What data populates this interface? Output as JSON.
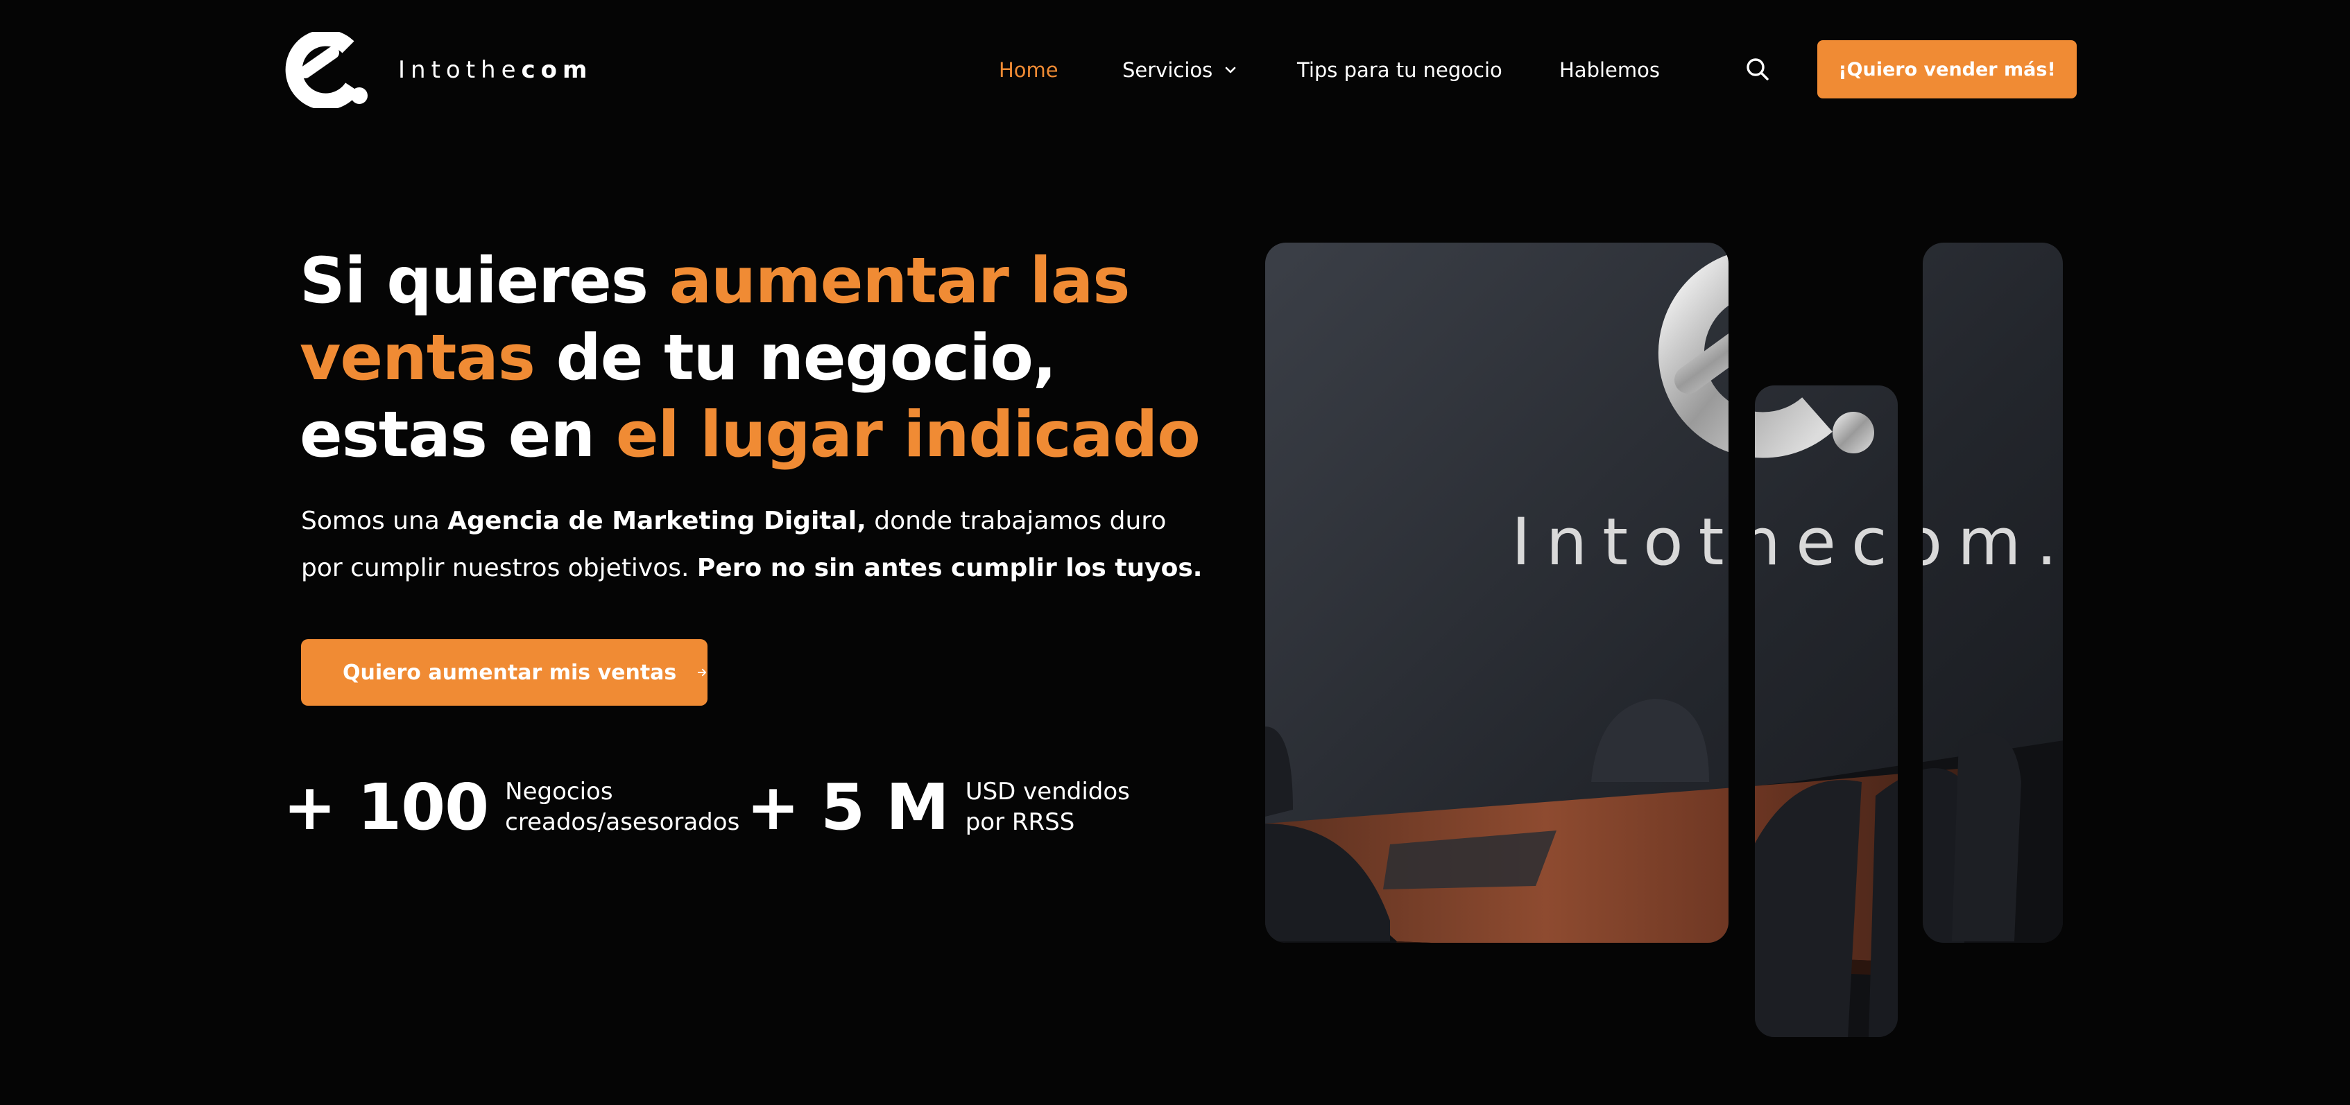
{
  "brand": {
    "name_light": "Intothe",
    "name_bold": "com",
    "accent_color": "#f08b34",
    "background_color": "#050505",
    "wall_sign": "Intothecom."
  },
  "nav": {
    "home": "Home",
    "servicios": "Servicios",
    "tips": "Tips para tu negocio",
    "hablemos": "Hablemos",
    "cta": "¡Quiero vender más!"
  },
  "hero": {
    "headline": {
      "part1": "Si quieres ",
      "part2": "aumentar las ventas",
      "part3": " de tu negocio, estas en ",
      "part4": "el lugar indicado"
    },
    "lede": {
      "p1": "Somos una ",
      "p2": "Agencia de Marketing Digital,",
      "p3": " donde trabajamos duro por cumplir nuestros objetivos. ",
      "p4": "Pero no sin antes cumplir los tuyos."
    },
    "cta_label": "Quiero aumentar mis ventas"
  },
  "stats": [
    {
      "number": "+ 100",
      "line1": "Negocios",
      "line2": "creados/asesorados"
    },
    {
      "number": "+ 5 M",
      "line1": "USD vendidos",
      "line2": "por RRSS"
    }
  ],
  "icons": {
    "logo": "intothecom-logo-icon",
    "dropdown": "chevron-down-icon",
    "search": "search-icon",
    "arrow": "arrow-right-icon"
  }
}
